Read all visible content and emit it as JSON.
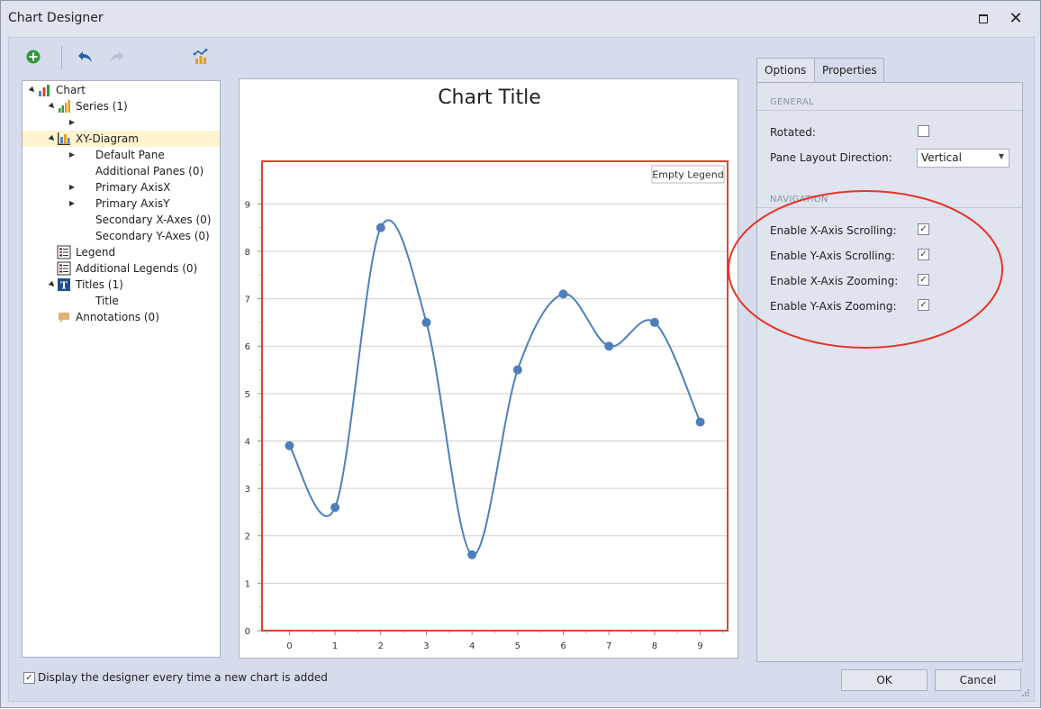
{
  "window": {
    "title": "Chart Designer"
  },
  "toolbar": {
    "add_icon": "add-icon",
    "undo_icon": "undo-icon",
    "redo_icon": "redo-icon",
    "wizard_icon": "chart-wizard-icon"
  },
  "tree": {
    "items": [
      {
        "label": "Chart",
        "icon": "chart-icon",
        "arrow": "▲"
      },
      {
        "label": "Series (1)",
        "icon": "series-icon",
        "arrow": "▲"
      },
      {
        "label": "",
        "icon": "",
        "arrow": "▶"
      },
      {
        "label": "XY-Diagram",
        "icon": "diagram-icon",
        "arrow": "▲"
      },
      {
        "label": "Default Pane",
        "icon": "",
        "arrow": "▶"
      },
      {
        "label": "Additional Panes (0)",
        "icon": "",
        "arrow": ""
      },
      {
        "label": "Primary AxisX",
        "icon": "",
        "arrow": "▶"
      },
      {
        "label": "Primary AxisY",
        "icon": "",
        "arrow": "▶"
      },
      {
        "label": "Secondary X-Axes (0)",
        "icon": "",
        "arrow": ""
      },
      {
        "label": "Secondary Y-Axes (0)",
        "icon": "",
        "arrow": ""
      },
      {
        "label": "Legend",
        "icon": "legend-icon",
        "arrow": ""
      },
      {
        "label": "Additional Legends (0)",
        "icon": "legend-icon",
        "arrow": ""
      },
      {
        "label": "Titles (1)",
        "icon": "title-icon",
        "arrow": "▲"
      },
      {
        "label": "Title",
        "icon": "",
        "arrow": ""
      },
      {
        "label": "Annotations (0)",
        "icon": "annotation-icon",
        "arrow": ""
      }
    ]
  },
  "chart": {
    "title": "Chart Title",
    "legend_text": "Empty Legend"
  },
  "chart_data": {
    "type": "line",
    "title": "Chart Title",
    "x": [
      0,
      1,
      2,
      3,
      4,
      5,
      6,
      7,
      8,
      9
    ],
    "series": [
      {
        "values": [
          3.9,
          2.6,
          8.5,
          6.5,
          1.6,
          5.5,
          7.1,
          6.0,
          6.5,
          4.4
        ]
      }
    ],
    "xlabel": "",
    "ylabel": "",
    "xlim": [
      -0.6,
      9.6
    ],
    "ylim": [
      0,
      9.9
    ],
    "yticks": [
      0,
      1,
      2,
      3,
      4,
      5,
      6,
      7,
      8,
      9
    ],
    "grid": true,
    "smooth": true,
    "legend_placement": "top-right",
    "colors": {
      "line": "#4f7fba",
      "marker": "#4f7fba",
      "plot_border": "#d8492c",
      "grid": "#d0d0d0"
    }
  },
  "tabs": [
    {
      "label": "Options",
      "active": true
    },
    {
      "label": "Properties",
      "active": false
    }
  ],
  "options": {
    "general_header": "GENERAL",
    "rotated_label": "Rotated:",
    "rotated_checked": false,
    "pane_layout_label": "Pane Layout Direction:",
    "pane_layout_value": "Vertical",
    "navigation_header": "NAVIGATION",
    "nav_items": [
      {
        "label": "Enable X-Axis Scrolling:",
        "checked": true
      },
      {
        "label": "Enable Y-Axis Scrolling:",
        "checked": true
      },
      {
        "label": "Enable X-Axis Zooming:",
        "checked": true
      },
      {
        "label": "Enable Y-Axis Zooming:",
        "checked": true
      }
    ]
  },
  "footer": {
    "display_label": "Display the designer every time a new chart is added",
    "display_checked": true,
    "ok_label": "OK",
    "cancel_label": "Cancel"
  },
  "highlight": {
    "color": "#e8322a"
  }
}
